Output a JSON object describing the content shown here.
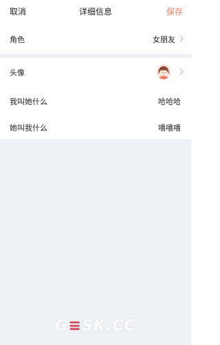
{
  "header": {
    "cancel_label": "取消",
    "title": "详细信息",
    "save_label": "保存"
  },
  "rows": {
    "role": {
      "label": "角色",
      "value": "女朋友"
    },
    "avatar": {
      "label": "头像",
      "icon": "girl-avatar"
    },
    "i_call_her": {
      "label": "我叫她什么",
      "value": "哈哈哈"
    },
    "she_calls_me": {
      "label": "她叫我什么",
      "value": "嘻嘻嘻"
    }
  },
  "colors": {
    "accent": "#e8806a",
    "background": "#eef1f5",
    "text": "#222222",
    "chevron": "#bbbbbb"
  },
  "watermark": {
    "part1": "G",
    "part2": "≡",
    "part3": "SK.CC"
  }
}
